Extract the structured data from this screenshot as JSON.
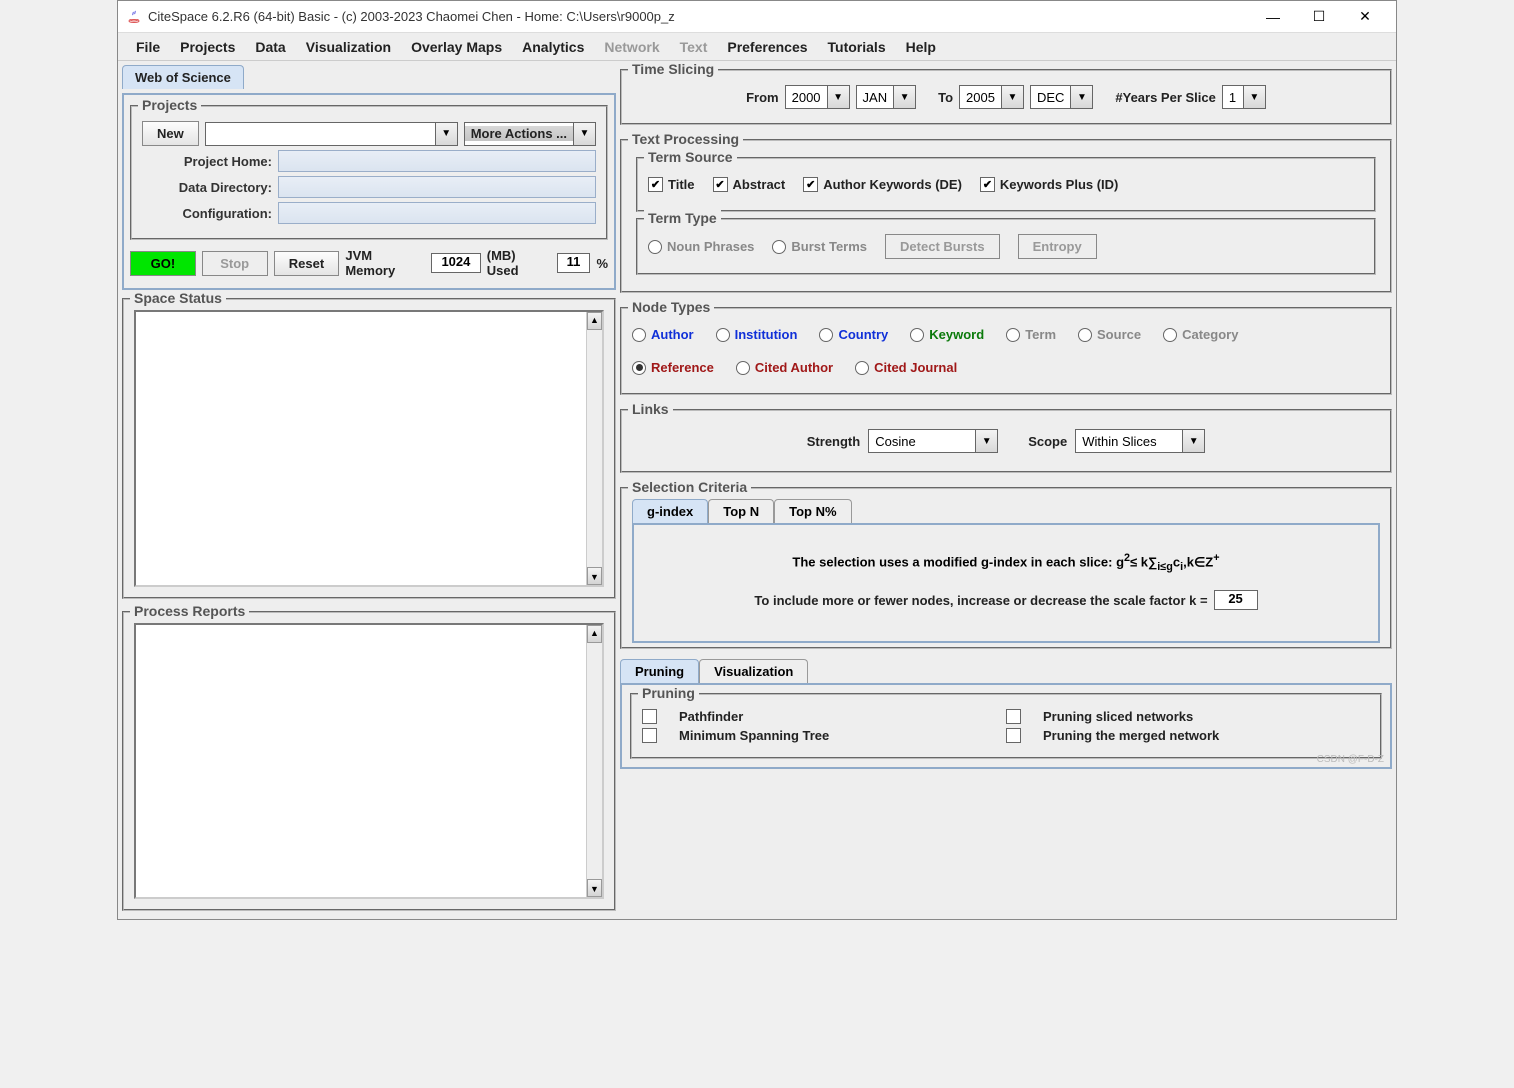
{
  "window": {
    "title": "CiteSpace 6.2.R6 (64-bit) Basic - (c) 2003-2023 Chaomei Chen - Home: C:\\Users\\r9000p_z"
  },
  "menus": [
    "File",
    "Projects",
    "Data",
    "Visualization",
    "Overlay Maps",
    "Analytics",
    "Network",
    "Text",
    "Preferences",
    "Tutorials",
    "Help"
  ],
  "menus_disabled": [
    "Network",
    "Text"
  ],
  "tabs": {
    "wos": "Web of Science"
  },
  "projects": {
    "legend": "Projects",
    "new_btn": "New",
    "more_actions": "More Actions ...",
    "home_label": "Project Home:",
    "data_label": "Data Directory:",
    "config_label": "Configuration:"
  },
  "controls": {
    "go": "GO!",
    "stop": "Stop",
    "reset": "Reset",
    "jvm_label": "JVM Memory",
    "jvm_value": "1024",
    "mb_used": "(MB) Used",
    "used_value": "11",
    "pct": "%"
  },
  "space_status": {
    "legend": "Space Status"
  },
  "process_reports": {
    "legend": "Process Reports"
  },
  "time_slicing": {
    "legend": "Time Slicing",
    "from": "From",
    "from_year": "2000",
    "from_month": "JAN",
    "to": "To",
    "to_year": "2005",
    "to_month": "DEC",
    "per_slice": "#Years Per Slice",
    "per_slice_val": "1"
  },
  "text_processing": {
    "legend": "Text Processing",
    "term_source_legend": "Term Source",
    "title": "Title",
    "abstract": "Abstract",
    "author_kw": "Author Keywords (DE)",
    "kw_plus": "Keywords Plus (ID)",
    "term_type_legend": "Term Type",
    "noun": "Noun Phrases",
    "burst": "Burst Terms",
    "detect": "Detect Bursts",
    "entropy": "Entropy"
  },
  "node_types": {
    "legend": "Node Types",
    "author": "Author",
    "institution": "Institution",
    "country": "Country",
    "keyword": "Keyword",
    "term": "Term",
    "source": "Source",
    "category": "Category",
    "reference": "Reference",
    "cited_author": "Cited Author",
    "cited_journal": "Cited Journal"
  },
  "links": {
    "legend": "Links",
    "strength": "Strength",
    "strength_val": "Cosine",
    "scope": "Scope",
    "scope_val": "Within Slices"
  },
  "selection": {
    "legend": "Selection Criteria",
    "tab_g": "g-index",
    "tab_n": "Top N",
    "tab_npct": "Top N%",
    "line1_a": "The selection uses a modified g-index in each slice:  g",
    "line1_b": "≤ k∑",
    "line1_c": "c",
    "line1_d": ",k∈Z",
    "line2": "To include more or fewer nodes, increase or decrease the scale factor k =",
    "k_value": "25"
  },
  "bottom": {
    "tab_pruning": "Pruning",
    "tab_viz": "Visualization",
    "pruning_legend": "Pruning",
    "pathfinder": "Pathfinder",
    "mst": "Minimum Spanning Tree",
    "psn": "Pruning sliced networks",
    "pmn": "Pruning the merged network"
  },
  "watermark": "CSDN @F-D-Z"
}
